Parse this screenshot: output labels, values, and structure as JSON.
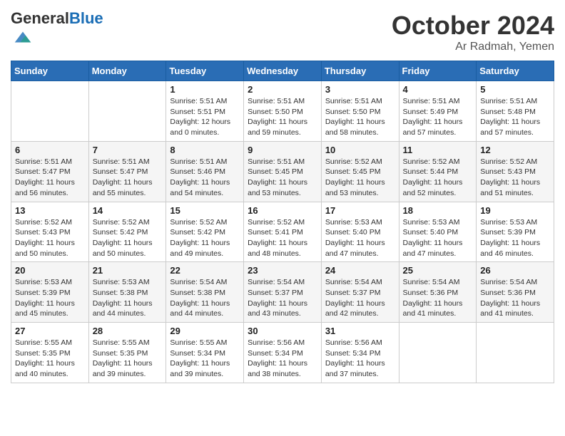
{
  "header": {
    "logo_general": "General",
    "logo_blue": "Blue",
    "month": "October 2024",
    "location": "Ar Radmah, Yemen"
  },
  "weekdays": [
    "Sunday",
    "Monday",
    "Tuesday",
    "Wednesday",
    "Thursday",
    "Friday",
    "Saturday"
  ],
  "weeks": [
    [
      {
        "day": "",
        "info": ""
      },
      {
        "day": "",
        "info": ""
      },
      {
        "day": "1",
        "info": "Sunrise: 5:51 AM\nSunset: 5:51 PM\nDaylight: 12 hours\nand 0 minutes."
      },
      {
        "day": "2",
        "info": "Sunrise: 5:51 AM\nSunset: 5:50 PM\nDaylight: 11 hours\nand 59 minutes."
      },
      {
        "day": "3",
        "info": "Sunrise: 5:51 AM\nSunset: 5:50 PM\nDaylight: 11 hours\nand 58 minutes."
      },
      {
        "day": "4",
        "info": "Sunrise: 5:51 AM\nSunset: 5:49 PM\nDaylight: 11 hours\nand 57 minutes."
      },
      {
        "day": "5",
        "info": "Sunrise: 5:51 AM\nSunset: 5:48 PM\nDaylight: 11 hours\nand 57 minutes."
      }
    ],
    [
      {
        "day": "6",
        "info": "Sunrise: 5:51 AM\nSunset: 5:47 PM\nDaylight: 11 hours\nand 56 minutes."
      },
      {
        "day": "7",
        "info": "Sunrise: 5:51 AM\nSunset: 5:47 PM\nDaylight: 11 hours\nand 55 minutes."
      },
      {
        "day": "8",
        "info": "Sunrise: 5:51 AM\nSunset: 5:46 PM\nDaylight: 11 hours\nand 54 minutes."
      },
      {
        "day": "9",
        "info": "Sunrise: 5:51 AM\nSunset: 5:45 PM\nDaylight: 11 hours\nand 53 minutes."
      },
      {
        "day": "10",
        "info": "Sunrise: 5:52 AM\nSunset: 5:45 PM\nDaylight: 11 hours\nand 53 minutes."
      },
      {
        "day": "11",
        "info": "Sunrise: 5:52 AM\nSunset: 5:44 PM\nDaylight: 11 hours\nand 52 minutes."
      },
      {
        "day": "12",
        "info": "Sunrise: 5:52 AM\nSunset: 5:43 PM\nDaylight: 11 hours\nand 51 minutes."
      }
    ],
    [
      {
        "day": "13",
        "info": "Sunrise: 5:52 AM\nSunset: 5:43 PM\nDaylight: 11 hours\nand 50 minutes."
      },
      {
        "day": "14",
        "info": "Sunrise: 5:52 AM\nSunset: 5:42 PM\nDaylight: 11 hours\nand 50 minutes."
      },
      {
        "day": "15",
        "info": "Sunrise: 5:52 AM\nSunset: 5:42 PM\nDaylight: 11 hours\nand 49 minutes."
      },
      {
        "day": "16",
        "info": "Sunrise: 5:52 AM\nSunset: 5:41 PM\nDaylight: 11 hours\nand 48 minutes."
      },
      {
        "day": "17",
        "info": "Sunrise: 5:53 AM\nSunset: 5:40 PM\nDaylight: 11 hours\nand 47 minutes."
      },
      {
        "day": "18",
        "info": "Sunrise: 5:53 AM\nSunset: 5:40 PM\nDaylight: 11 hours\nand 47 minutes."
      },
      {
        "day": "19",
        "info": "Sunrise: 5:53 AM\nSunset: 5:39 PM\nDaylight: 11 hours\nand 46 minutes."
      }
    ],
    [
      {
        "day": "20",
        "info": "Sunrise: 5:53 AM\nSunset: 5:39 PM\nDaylight: 11 hours\nand 45 minutes."
      },
      {
        "day": "21",
        "info": "Sunrise: 5:53 AM\nSunset: 5:38 PM\nDaylight: 11 hours\nand 44 minutes."
      },
      {
        "day": "22",
        "info": "Sunrise: 5:54 AM\nSunset: 5:38 PM\nDaylight: 11 hours\nand 44 minutes."
      },
      {
        "day": "23",
        "info": "Sunrise: 5:54 AM\nSunset: 5:37 PM\nDaylight: 11 hours\nand 43 minutes."
      },
      {
        "day": "24",
        "info": "Sunrise: 5:54 AM\nSunset: 5:37 PM\nDaylight: 11 hours\nand 42 minutes."
      },
      {
        "day": "25",
        "info": "Sunrise: 5:54 AM\nSunset: 5:36 PM\nDaylight: 11 hours\nand 41 minutes."
      },
      {
        "day": "26",
        "info": "Sunrise: 5:54 AM\nSunset: 5:36 PM\nDaylight: 11 hours\nand 41 minutes."
      }
    ],
    [
      {
        "day": "27",
        "info": "Sunrise: 5:55 AM\nSunset: 5:35 PM\nDaylight: 11 hours\nand 40 minutes."
      },
      {
        "day": "28",
        "info": "Sunrise: 5:55 AM\nSunset: 5:35 PM\nDaylight: 11 hours\nand 39 minutes."
      },
      {
        "day": "29",
        "info": "Sunrise: 5:55 AM\nSunset: 5:34 PM\nDaylight: 11 hours\nand 39 minutes."
      },
      {
        "day": "30",
        "info": "Sunrise: 5:56 AM\nSunset: 5:34 PM\nDaylight: 11 hours\nand 38 minutes."
      },
      {
        "day": "31",
        "info": "Sunrise: 5:56 AM\nSunset: 5:34 PM\nDaylight: 11 hours\nand 37 minutes."
      },
      {
        "day": "",
        "info": ""
      },
      {
        "day": "",
        "info": ""
      }
    ]
  ]
}
